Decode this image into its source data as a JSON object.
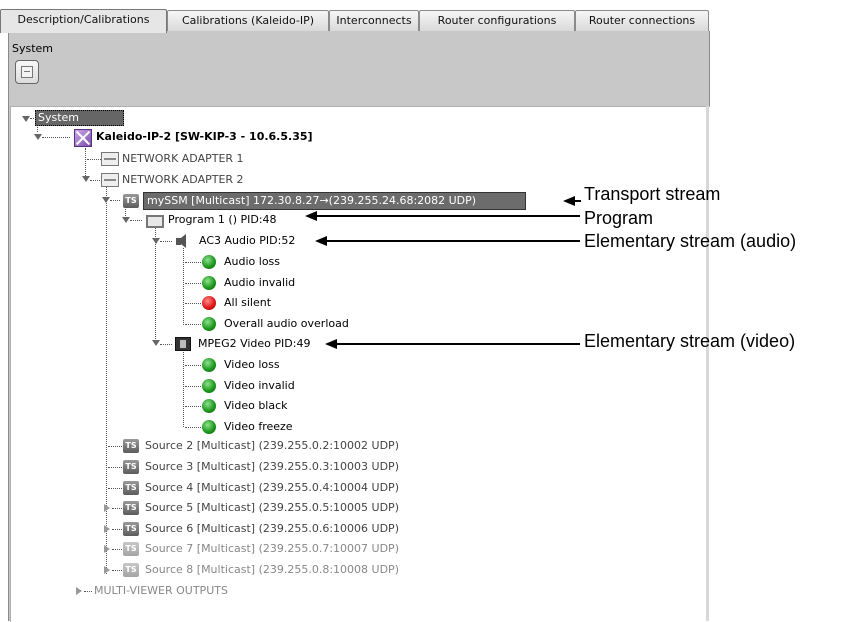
{
  "tabs": [
    {
      "label": "Description/Calibrations",
      "active": true
    },
    {
      "label": "Calibrations (Kaleido-IP)",
      "active": false
    },
    {
      "label": "Interconnects",
      "active": false
    },
    {
      "label": "Router configurations",
      "active": false
    },
    {
      "label": "Router connections",
      "active": false
    }
  ],
  "panel": {
    "system_label": "System",
    "system_button_icon": "collapse-icon"
  },
  "tree": {
    "root": "System",
    "device": "Kaleido-IP-2 [SW-KIP-3 - 10.6.5.35]",
    "adapter1": "NETWORK ADAPTER 1",
    "adapter2": "NETWORK ADAPTER 2",
    "ssm": "mySSM [Multicast] 172.30.8.27→(239.255.24.68:2082 UDP)",
    "program": "Program 1 () PID:48",
    "audio": "AC3 Audio PID:52",
    "audio_alarms": [
      {
        "label": "Audio loss",
        "status": "green"
      },
      {
        "label": "Audio invalid",
        "status": "green"
      },
      {
        "label": "All silent",
        "status": "red"
      },
      {
        "label": "Overall audio overload",
        "status": "green"
      }
    ],
    "video": "MPEG2 Video PID:49",
    "video_alarms": [
      {
        "label": "Video loss",
        "status": "green"
      },
      {
        "label": "Video invalid",
        "status": "green"
      },
      {
        "label": "Video black",
        "status": "green"
      },
      {
        "label": "Video freeze",
        "status": "green"
      }
    ],
    "sources": [
      "Source 2 [Multicast] (239.255.0.2:10002 UDP)",
      "Source 3 [Multicast] (239.255.0.3:10003 UDP)",
      "Source 4 [Multicast] (239.255.0.4:10004 UDP)",
      "Source 5 [Multicast] (239.255.0.5:10005 UDP)",
      "Source 6 [Multicast] (239.255.0.6:10006 UDP)",
      "Source 7 [Multicast] (239.255.0.7:10007 UDP)",
      "Source 8 [Multicast] (239.255.0.8:10008 UDP)"
    ],
    "multiviewer": "MULTI-VIEWER OUTPUTS"
  },
  "annotations": {
    "transport": "Transport stream",
    "program": "Program",
    "audio": "Elementary stream (audio)",
    "video": "Elementary stream (video)"
  },
  "colors": {
    "status_green": "#1e9a1e",
    "status_red": "#e01818",
    "selection": "#6c6c6c"
  }
}
